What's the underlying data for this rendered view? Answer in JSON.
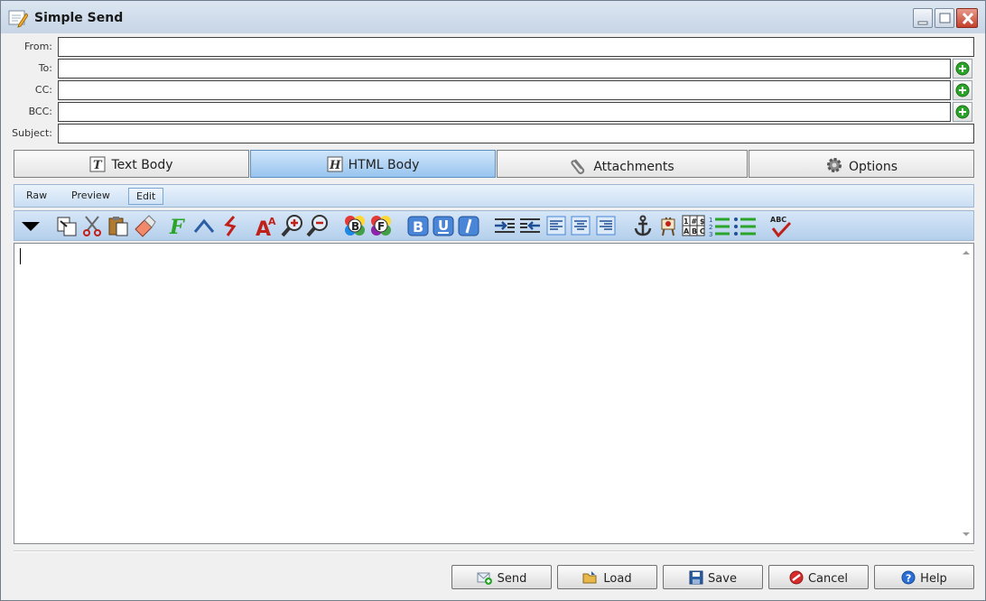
{
  "window": {
    "title": "Simple Send"
  },
  "fields": {
    "from": {
      "label": "From:",
      "value": ""
    },
    "to": {
      "label": "To:",
      "value": ""
    },
    "cc": {
      "label": "CC:",
      "value": ""
    },
    "bcc": {
      "label": "BCC:",
      "value": ""
    },
    "subject": {
      "label": "Subject:",
      "value": ""
    }
  },
  "tabs": [
    {
      "label": "Text Body",
      "icon": "text-body-icon",
      "active": false
    },
    {
      "label": "HTML Body",
      "icon": "html-body-icon",
      "active": true
    },
    {
      "label": "Attachments",
      "icon": "paperclip-icon",
      "active": false
    },
    {
      "label": "Options",
      "icon": "gear-icon",
      "active": false
    }
  ],
  "subtabs": [
    {
      "label": "Raw",
      "active": false
    },
    {
      "label": "Preview",
      "active": false
    },
    {
      "label": "Edit",
      "active": true
    }
  ],
  "toolbar_icons": [
    "dropdown-arrow-icon",
    "copy-icon",
    "cut-icon",
    "paste-icon",
    "eraser-icon",
    "font-icon",
    "superscript-icon",
    "subscript-icon",
    "font-size-icon",
    "zoom-in-icon",
    "zoom-out-icon",
    "background-color-icon",
    "foreground-color-icon",
    "bold-icon",
    "underline-icon",
    "italic-icon",
    "indent-icon",
    "outdent-icon",
    "align-left-icon",
    "align-center-icon",
    "align-right-icon",
    "anchor-icon",
    "image-icon",
    "table-icon",
    "numbered-list-icon",
    "bullet-list-icon",
    "spellcheck-icon"
  ],
  "editor": {
    "content": ""
  },
  "buttons": {
    "send": "Send",
    "load": "Load",
    "save": "Save",
    "cancel": "Cancel",
    "help": "Help"
  },
  "colors": {
    "accent_blue": "#98c4ef",
    "add_green": "#2aa52a",
    "cancel_red": "#d62b2b",
    "help_blue": "#2b6fd6"
  }
}
